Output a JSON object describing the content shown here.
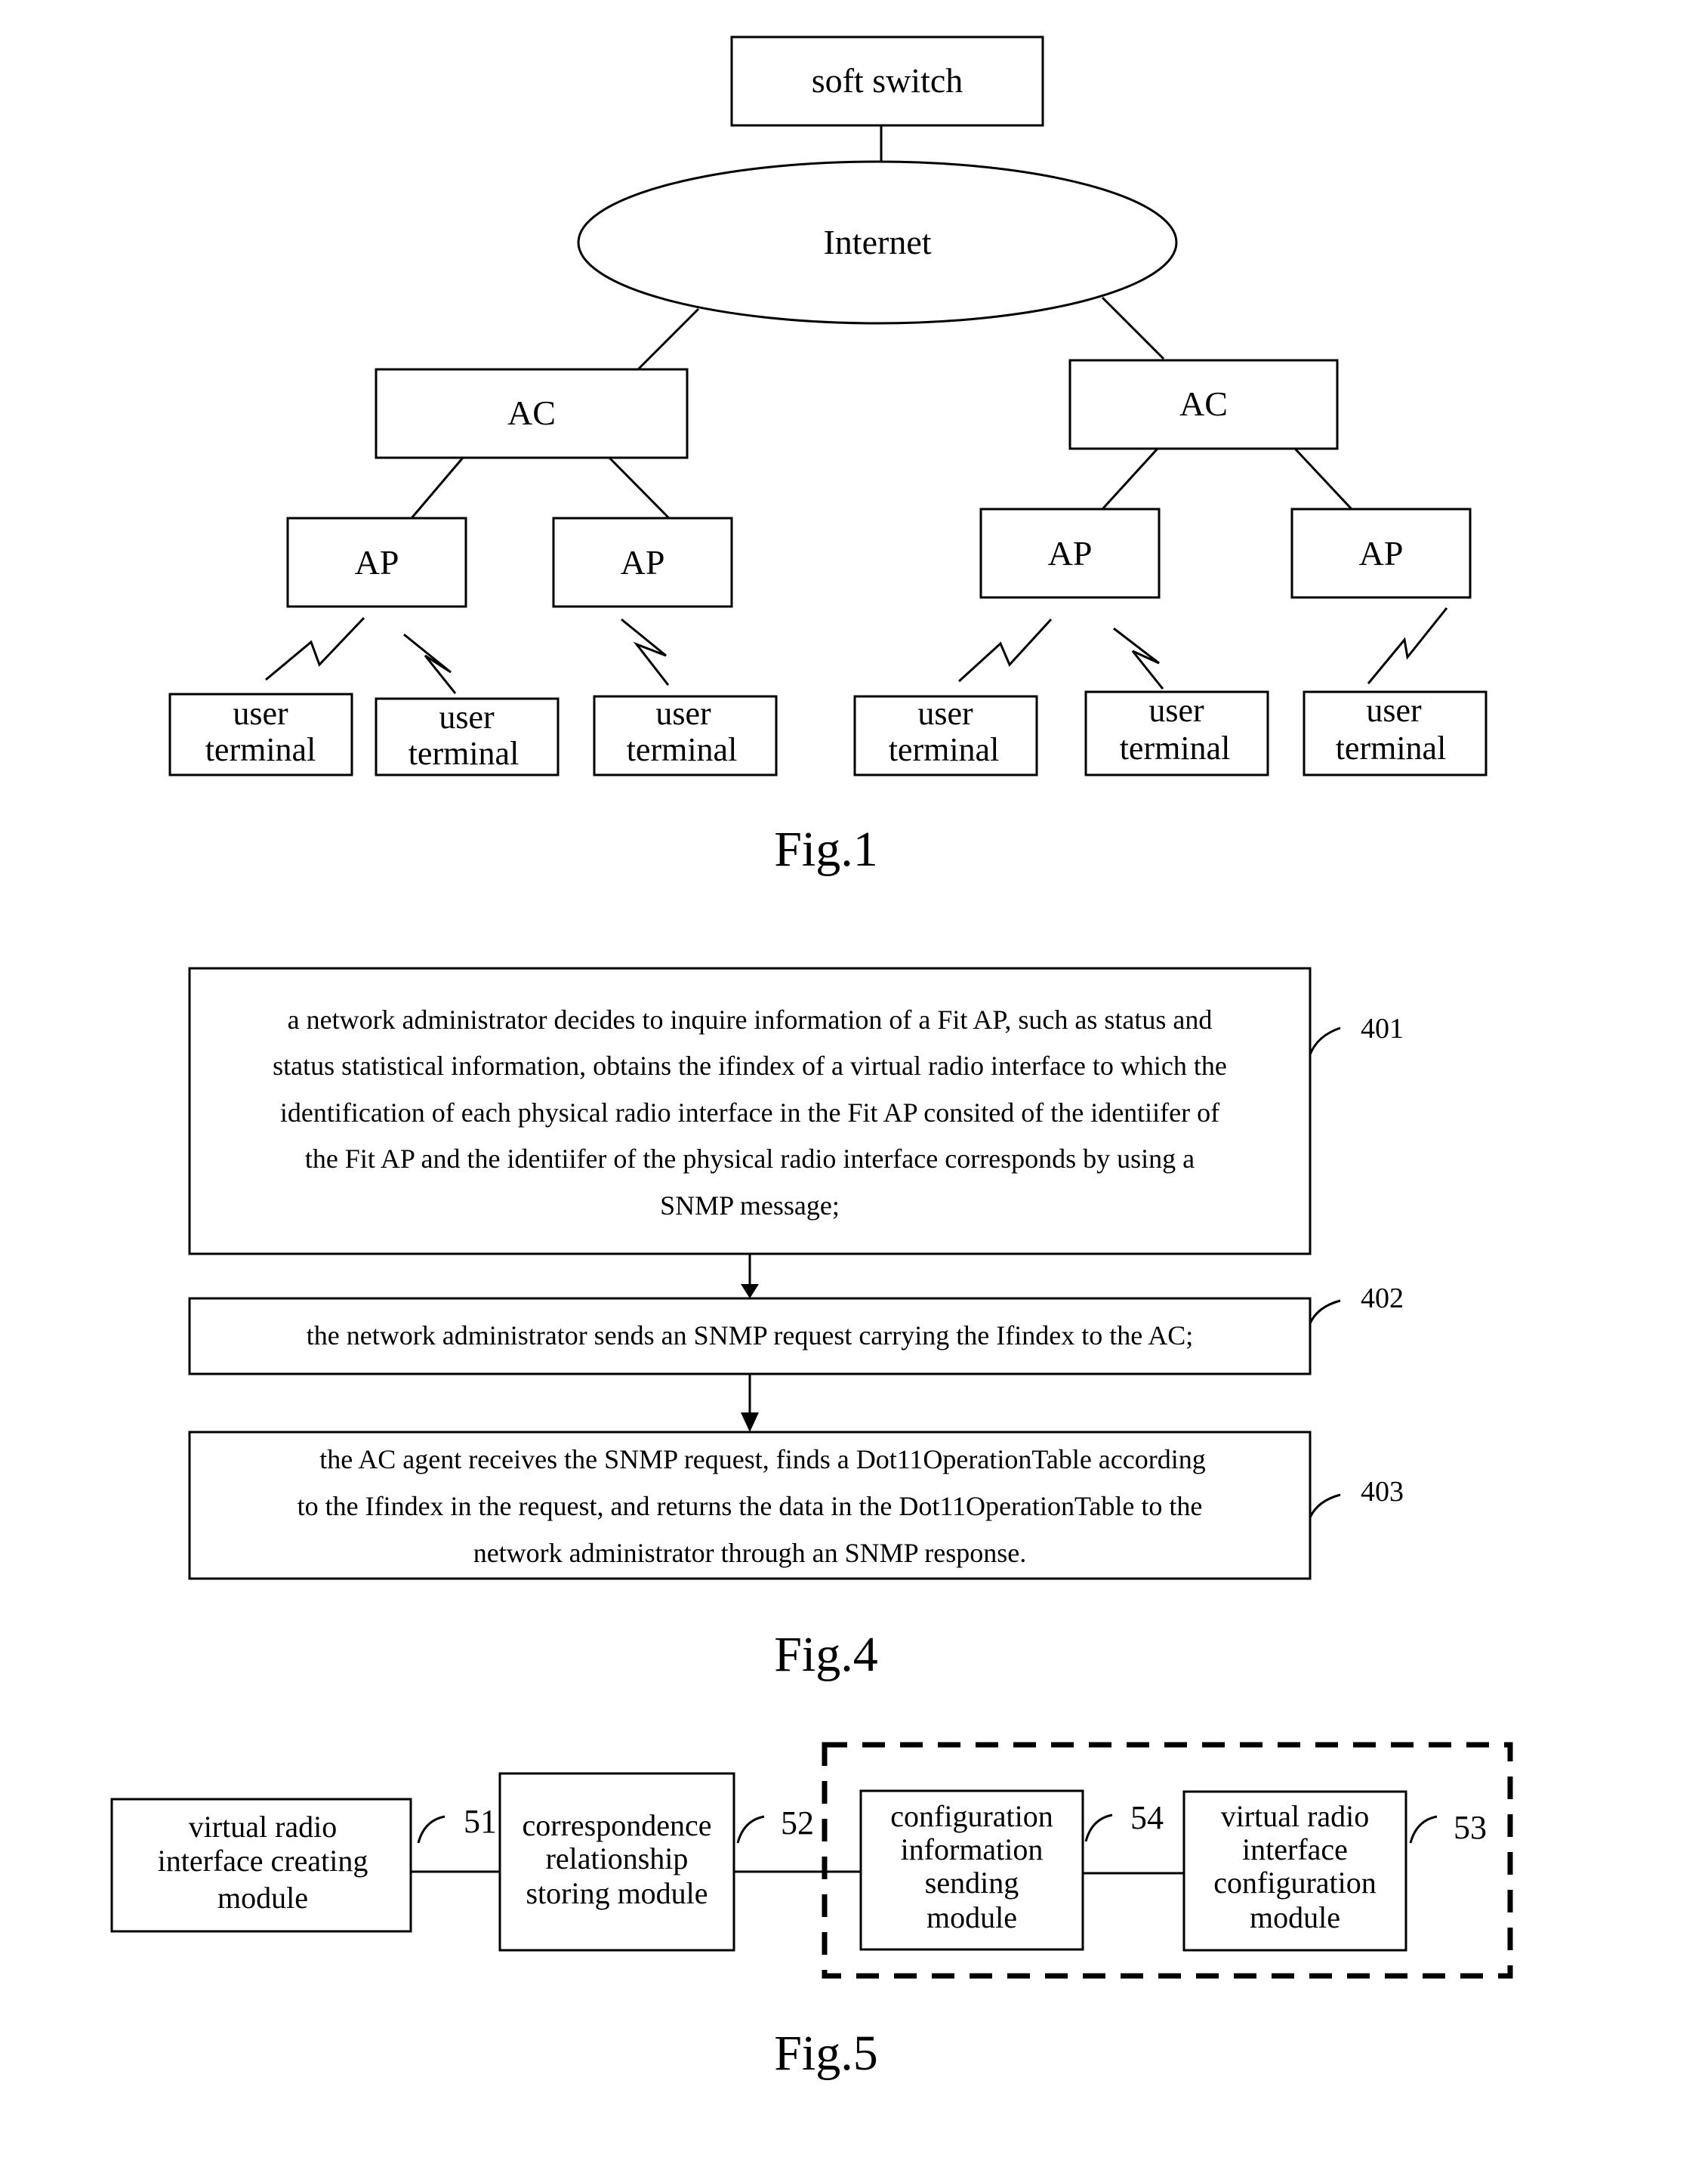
{
  "fig1": {
    "caption": "Fig.1",
    "soft_switch": "soft switch",
    "internet": "Internet",
    "ac_left": "AC",
    "ac_right": "AC",
    "ap": [
      "AP",
      "AP",
      "AP",
      "AP"
    ],
    "user_terminal_line1": "user",
    "user_terminal_line2": "terminal"
  },
  "fig4": {
    "caption": "Fig.4",
    "steps": [
      {
        "ref": "401",
        "lines": [
          "a network administrator decides to inquire information of a Fit AP, such as status and",
          "status statistical information, obtains the ifindex of a virtual radio interface to which the",
          "identification of each physical radio interface in the Fit AP consited of the identiifer of",
          "the Fit AP and the identiifer  of the physical radio interface corresponds by using a",
          "SNMP message;"
        ]
      },
      {
        "ref": "402",
        "lines": [
          "the network administrator sends an SNMP request carrying the Ifindex to the AC;"
        ]
      },
      {
        "ref": "403",
        "lines": [
          "the AC agent receives the SNMP request, finds a Dot11OperationTable according",
          "to the Ifindex in the request, and returns the data in the Dot11OperationTable to the",
          "network administrator through an SNMP response."
        ]
      }
    ]
  },
  "fig5": {
    "caption": "Fig.5",
    "modules": [
      {
        "ref": "51",
        "lines": [
          "virtual radio",
          "interface creating",
          "module"
        ]
      },
      {
        "ref": "52",
        "lines": [
          "correspondence",
          "relationship",
          "storing module"
        ]
      },
      {
        "ref": "54",
        "lines": [
          "configuration",
          "information",
          "sending",
          "module"
        ]
      },
      {
        "ref": "53",
        "lines": [
          "virtual radio",
          "interface",
          "configuration",
          "module"
        ]
      }
    ]
  }
}
